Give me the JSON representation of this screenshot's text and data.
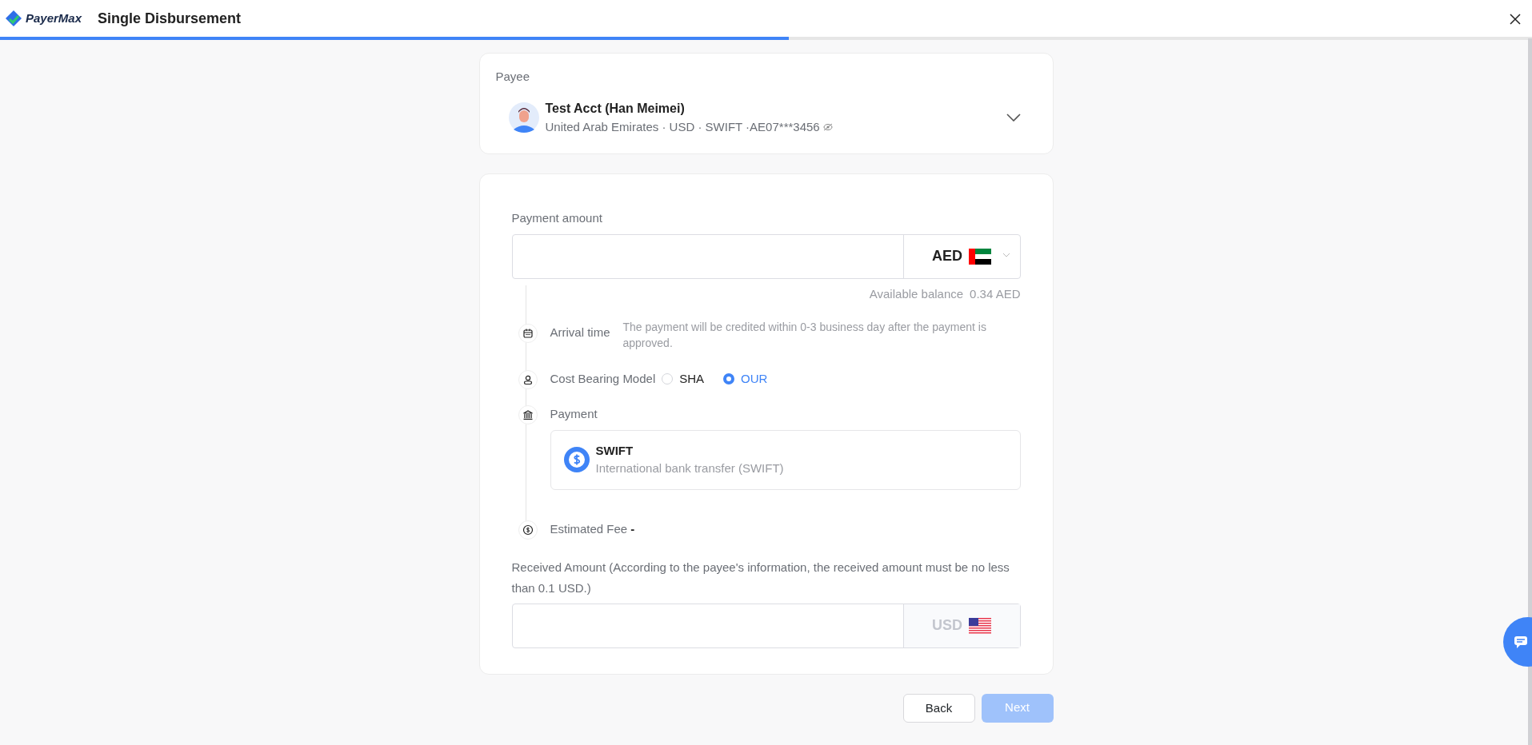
{
  "header": {
    "logo_text": "PayerMax",
    "title": "Single Disbursement",
    "progress": {
      "level": 0.515
    }
  },
  "payee": {
    "label": "Payee",
    "name": "Test Acct (Han Meimei)",
    "details": "United Arab Emirates · USD · SWIFT ·AE07***3456"
  },
  "payment_amount": {
    "label": "Payment amount",
    "currency": "AED",
    "balance_label": "Available balance",
    "balance": "0.34 AED"
  },
  "steps": [
    {
      "kind": "info",
      "label": "Arrival time",
      "text": "The payment will be credited within 0-3 business day after the payment is approved."
    },
    {
      "kind": "radio",
      "label": "Cost Bearing Model",
      "options": [
        {
          "label": "SHA",
          "selected": false
        },
        {
          "label": "OUR",
          "selected": true
        }
      ]
    },
    {
      "kind": "method",
      "label": "Payment",
      "method": {
        "name": "SWIFT",
        "description": "International bank transfer (SWIFT)"
      }
    },
    {
      "kind": "value",
      "label": "Estimated Fee",
      "value": "-"
    }
  ],
  "received_amount": {
    "label": "Received Amount (According to the payee's information, the received amount must be no less than 0.1 USD.)",
    "currency": "USD",
    "disabled": true
  },
  "buttons": [
    {
      "label": "Back",
      "disabled": false
    },
    {
      "label": "Next",
      "disabled": true
    }
  ]
}
